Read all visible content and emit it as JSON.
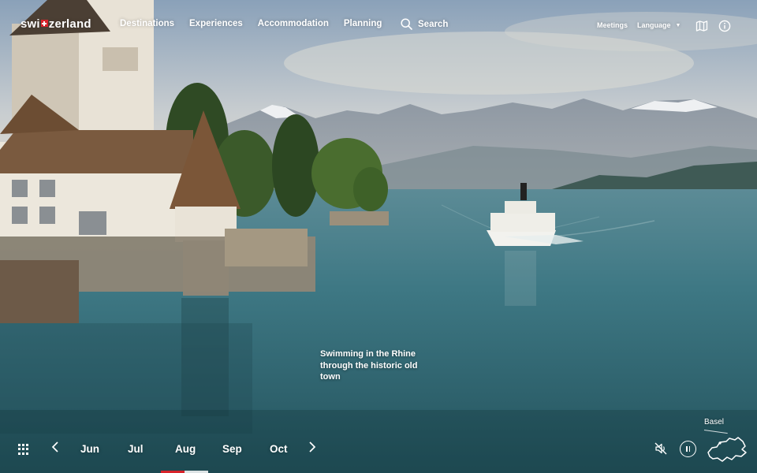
{
  "brand": {
    "prefix": "swi",
    "suffix": "zerland"
  },
  "nav": {
    "items": [
      "Destinations",
      "Experiences",
      "Accommodation",
      "Planning"
    ],
    "search_label": "Search",
    "meetings_label": "Meetings",
    "language_label": "Language"
  },
  "icons": {
    "search": "search-icon",
    "map": "map-icon",
    "info": "info-icon",
    "grid": "grid-icon",
    "prev": "chevron-left-icon",
    "next": "chevron-right-icon",
    "mute": "sound-muted-icon",
    "pause": "pause-icon",
    "location_map": "switzerland-map-icon"
  },
  "caption": "Swimming in the Rhine through the historic old town",
  "timeline": {
    "months": [
      "Jun",
      "Jul",
      "Aug",
      "Sep",
      "Oct"
    ],
    "active_month": "Aug",
    "progress": 0.5
  },
  "location": {
    "label": "Basel"
  },
  "colors": {
    "accent": "#d8232a",
    "text": "#ffffff"
  }
}
